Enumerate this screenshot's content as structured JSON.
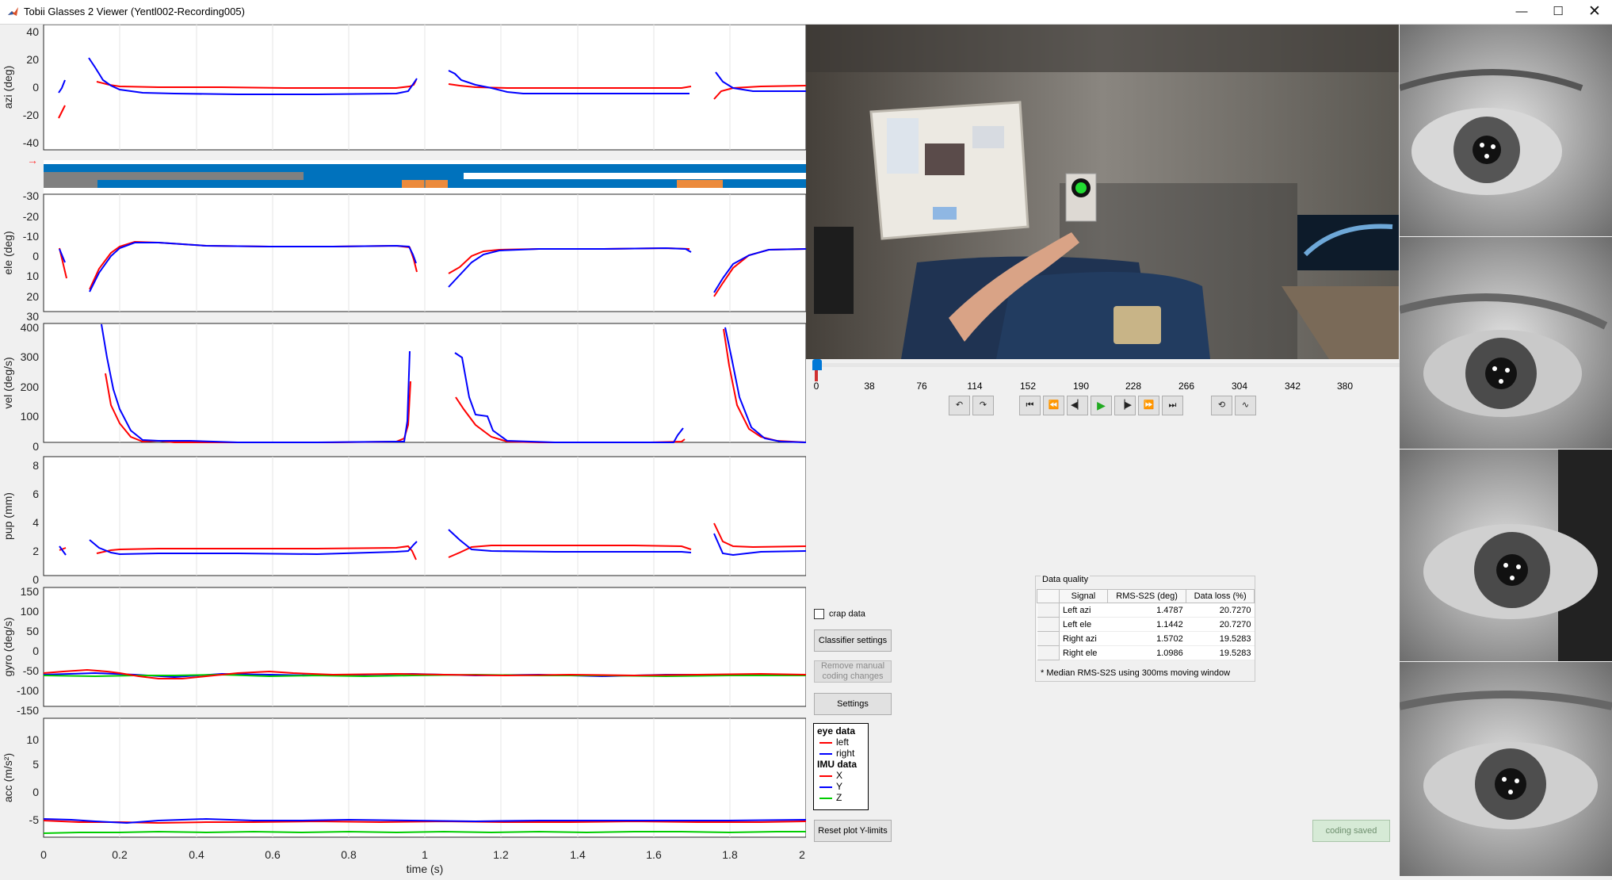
{
  "window": {
    "title": "Tobii Glasses 2 Viewer (Yentl002-Recording005)",
    "minimize_glyph": "—",
    "maximize_glyph": "☐",
    "close_glyph": "✕"
  },
  "plots": {
    "x_ticks": [
      "0",
      "0.2",
      "0.4",
      "0.6",
      "0.8",
      "1",
      "1.2",
      "1.4",
      "1.6",
      "1.8",
      "2"
    ],
    "xlabel": "time (s)",
    "panels": [
      {
        "id": "azi",
        "ylabel": "azi (deg)",
        "ticks": [
          "40",
          "20",
          "0",
          "-20",
          "-40"
        ]
      },
      {
        "id": "ele",
        "ylabel": "ele (deg)",
        "ticks": [
          "-30",
          "-20",
          "-10",
          "0",
          "10",
          "20",
          "30"
        ]
      },
      {
        "id": "vel",
        "ylabel": "vel (deg/s)",
        "ticks": [
          "400",
          "300",
          "200",
          "100",
          "0"
        ]
      },
      {
        "id": "pup",
        "ylabel": "pup (mm)",
        "ticks": [
          "8",
          "6",
          "4",
          "2",
          "0"
        ]
      },
      {
        "id": "gyro",
        "ylabel": "gyro (deg/s)",
        "ticks": [
          "150",
          "100",
          "50",
          "0",
          "-50",
          "-100",
          "-150"
        ]
      },
      {
        "id": "acc",
        "ylabel": "acc (m/s²)",
        "ticks": [
          "10",
          "5",
          "0",
          "-5"
        ]
      }
    ],
    "coding_arrow": "→"
  },
  "video": {
    "timeline_ticks": [
      "0",
      "38",
      "76",
      "114",
      "152",
      "190",
      "228",
      "266",
      "304",
      "342",
      "380"
    ],
    "position_fraction": 0.0
  },
  "controls": {
    "crap_data_label": "crap data",
    "classifier_settings": "Classifier settings",
    "remove_manual_coding": "Remove manual coding changes",
    "settings": "Settings",
    "reset_ylimits": "Reset plot Y-limits",
    "coding_saved": "coding saved"
  },
  "legend": {
    "eye_header": "eye data",
    "left": "left",
    "right": "right",
    "imu_header": "IMU data",
    "x": "X",
    "y": "Y",
    "z": "Z"
  },
  "colors": {
    "left": "#ff0000",
    "right": "#0000ff",
    "x": "#ff0000",
    "y": "#0000ff",
    "z": "#00cc00",
    "coding_blue": "#0072bd",
    "coding_gray": "#808080",
    "coding_orange": "#ec8a3b"
  },
  "data_quality": {
    "title": "Data quality",
    "columns": [
      "Signal",
      "RMS-S2S (deg)",
      "Data loss (%)"
    ],
    "rows": [
      {
        "signal": "Left azi",
        "rms": "1.4787",
        "loss": "20.7270"
      },
      {
        "signal": "Left ele",
        "rms": "1.1442",
        "loss": "20.7270"
      },
      {
        "signal": "Right azi",
        "rms": "1.5702",
        "loss": "19.5283"
      },
      {
        "signal": "Right ele",
        "rms": "1.0986",
        "loss": "19.5283"
      }
    ],
    "note": "* Median RMS-S2S using 300ms moving window"
  }
}
